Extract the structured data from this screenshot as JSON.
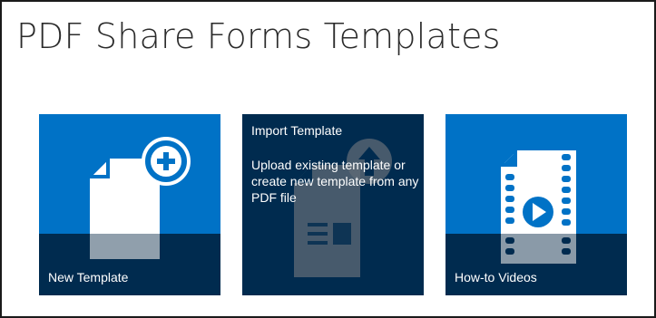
{
  "page": {
    "title": "PDF Share Forms Templates"
  },
  "tiles": [
    {
      "label": "New Template",
      "icon": "new-document-plus-icon"
    },
    {
      "heading": "Import Template",
      "description": "Upload existing template or create new template from any PDF file",
      "icon": "upload-document-icon"
    },
    {
      "label": "How-to Videos",
      "icon": "video-film-icon"
    }
  ],
  "colors": {
    "tile_blue": "#0072c6",
    "tile_dark": "#002b4f",
    "text": "#2b2b2b"
  }
}
